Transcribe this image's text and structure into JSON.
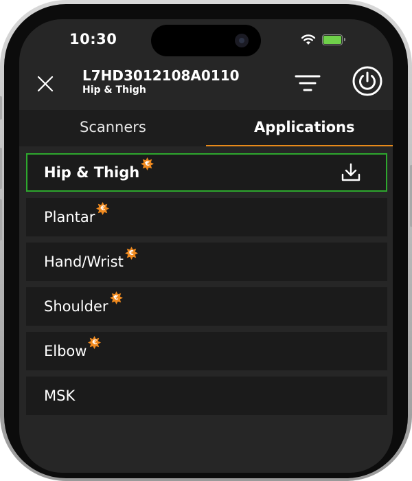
{
  "status_bar": {
    "time": "10:30"
  },
  "header": {
    "device_id": "L7HD3012108A0110",
    "subtitle": "Hip & Thigh"
  },
  "tabs": [
    {
      "label": "Scanners",
      "active": false
    },
    {
      "label": "Applications",
      "active": true
    }
  ],
  "applications": [
    {
      "label": "Hip & Thigh",
      "selected": true,
      "badge": "€"
    },
    {
      "label": "Plantar",
      "selected": false,
      "badge": "€"
    },
    {
      "label": "Hand/Wrist",
      "selected": false,
      "badge": "€"
    },
    {
      "label": "Shoulder",
      "selected": false,
      "badge": "€"
    },
    {
      "label": "Elbow",
      "selected": false,
      "badge": "€"
    },
    {
      "label": "MSK",
      "selected": false,
      "badge": ""
    }
  ],
  "icons": {
    "close": "close-icon",
    "filter": "filter-icon",
    "power": "power-icon",
    "download": "download-icon",
    "badge": "euro-badge-icon",
    "wifi": "wifi-icon",
    "battery": "battery-icon"
  },
  "colors": {
    "accent": "#e88a1a",
    "selected_border": "#2ea82e",
    "badge": "#f08a1f",
    "battery": "#6fd04a",
    "background": "#262626"
  }
}
